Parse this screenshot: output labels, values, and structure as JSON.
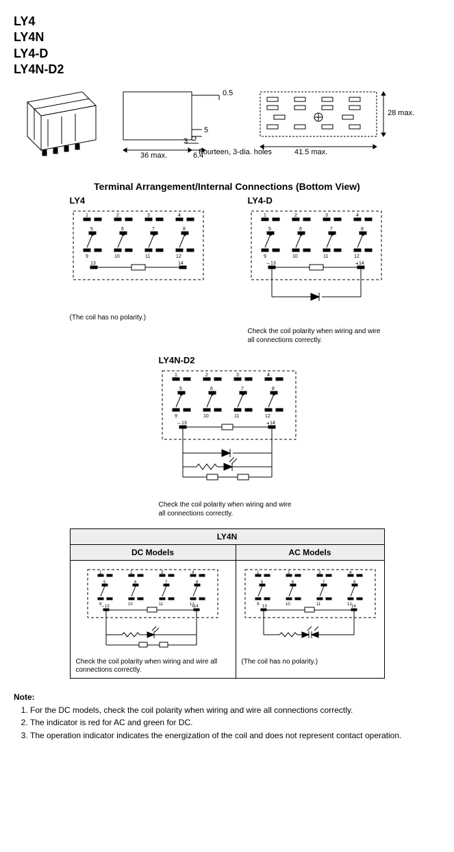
{
  "models": [
    "LY4",
    "LY4N",
    "LY4-D",
    "LY4N-D2"
  ],
  "dimensions": {
    "width": "36 max.",
    "pin_offset": "6.4",
    "pin_gap": "3",
    "pin_h": "5",
    "pin_top": "0.5",
    "footprint_w": "41.5 max.",
    "footprint_h": "28 max.",
    "holes": "Fourteen, 3-dia. holes"
  },
  "section_title": "Terminal Arrangement/Internal Connections (Bottom View)",
  "schematics": {
    "ly4": {
      "label": "LY4",
      "caption": "(The coil has no polarity.)"
    },
    "ly4d": {
      "label": "LY4-D",
      "caption": "Check the coil polarity when wiring and wire all connections correctly."
    },
    "ly4nd2": {
      "label": "LY4N-D2",
      "caption": "Check the coil polarity when wiring and wire all connections correctly."
    }
  },
  "table": {
    "title": "LY4N",
    "col1": "DC Models",
    "col2": "AC Models",
    "dc_caption": "Check the coil polarity when wiring and wire all connections correctly.",
    "ac_caption": "(The coil has no polarity.)"
  },
  "notes_heading": "Note:",
  "notes": [
    "For the DC models, check the coil polarity when wiring and wire all connections correctly.",
    "The indicator is red for AC and green for DC.",
    "The operation indicator indicates the energization of the coil and does not represent contact operation."
  ],
  "pin_numbers": [
    "1",
    "2",
    "3",
    "4",
    "5",
    "6",
    "7",
    "8",
    "9",
    "10",
    "11",
    "12",
    "13",
    "14"
  ]
}
